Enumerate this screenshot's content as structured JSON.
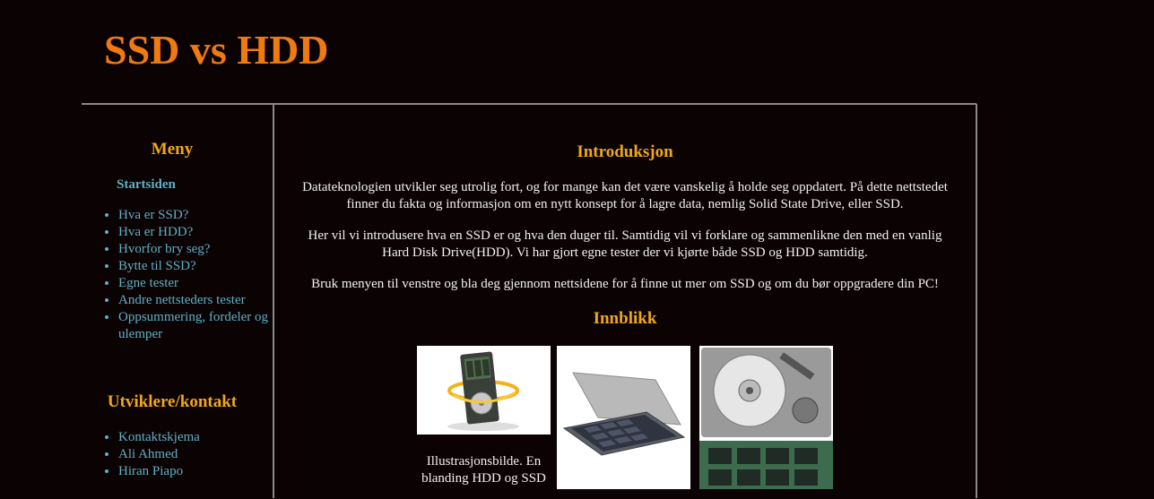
{
  "header": {
    "title": "SSD vs HDD"
  },
  "sidebar": {
    "menu_heading": "Meny",
    "home_link": "Startsiden",
    "menu_items": [
      "Hva er SSD?",
      "Hva er HDD?",
      "Hvorfor bry seg?",
      "Bytte til SSD?",
      "Egne tester",
      "Andre nettsteders tester",
      "Oppsummering, fordeler og ulemper"
    ],
    "contact_heading": "Utviklere/kontakt",
    "contact_items": [
      "Kontaktskjema",
      "Ali Ahmed",
      "Hiran Piapo"
    ]
  },
  "main": {
    "intro_heading": "Introduksjon",
    "paragraphs": [
      "Datateknologien utvikler seg utrolig fort, og for mange kan det være vanskelig å holde seg oppdatert. På dette nettstedet finner du fakta og informasjon om en nytt konsept for å lagre data, nemlig Solid State Drive, eller SSD.",
      "Her vil vi introdusere hva en SSD er og hva den duger til. Samtidig vil vi forklare og sammenlikne den med en vanlig Hard Disk Drive(HDD). Vi har gjort egne tester der vi kjørte både SSD og HDD samtidig.",
      "Bruk menyen til venstre og bla deg gjennom nettsidene for å finne ut mer om SSD og om du bør oppgradere din PC!"
    ],
    "insight_heading": "Innblikk",
    "image_caption": "Illustrasjonsbilde. En blanding HDD og SSD"
  },
  "colors": {
    "background": "#0b0203",
    "title": "#f07a10",
    "heading": "#f0a818",
    "link": "#5fb0c4",
    "border": "#8a8a8a"
  }
}
